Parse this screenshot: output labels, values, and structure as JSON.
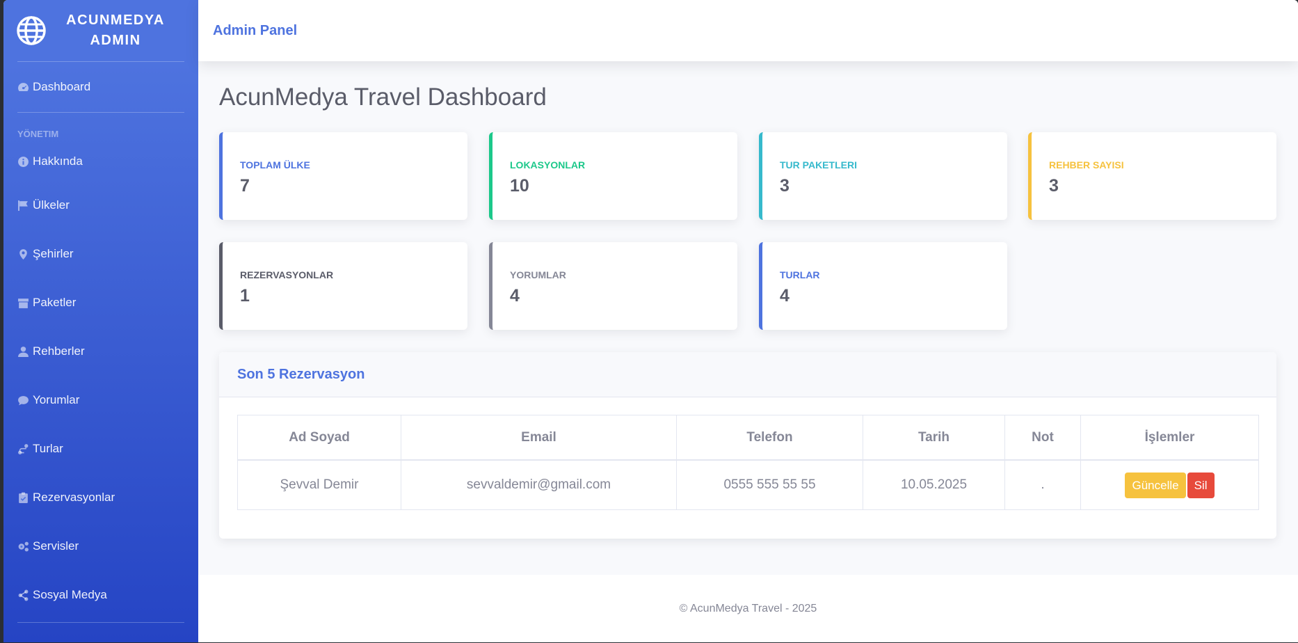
{
  "sidebar": {
    "brand": "ACUNMEDYA ADMIN",
    "dashboard": "Dashboard",
    "heading": "YÖNETIM",
    "items": [
      {
        "label": "Hakkında",
        "icon": "info-icon"
      },
      {
        "label": "Ülkeler",
        "icon": "flag-icon"
      },
      {
        "label": "Şehirler",
        "icon": "map-marker-icon"
      },
      {
        "label": "Paketler",
        "icon": "box-icon"
      },
      {
        "label": "Rehberler",
        "icon": "user-tie-icon"
      },
      {
        "label": "Yorumlar",
        "icon": "comment-icon"
      },
      {
        "label": "Turlar",
        "icon": "route-icon"
      },
      {
        "label": "Rezervasyonlar",
        "icon": "clipboard-check-icon"
      },
      {
        "label": "Servisler",
        "icon": "cogs-icon"
      },
      {
        "label": "Sosyal Medya",
        "icon": "share-icon"
      }
    ]
  },
  "topbar": {
    "title": "Admin Panel"
  },
  "page": {
    "title": "AcunMedya Travel Dashboard"
  },
  "cards": [
    {
      "label": "TOPLAM ÜLKE",
      "value": "7",
      "color": "#4e73df"
    },
    {
      "label": "LOKASYONLAR",
      "value": "10",
      "color": "#1cc88a"
    },
    {
      "label": "TUR PAKETLERI",
      "value": "3",
      "color": "#36b9cc"
    },
    {
      "label": "REHBER SAYISI",
      "value": "3",
      "color": "#f6c23e"
    },
    {
      "label": "REZERVASYONLAR",
      "value": "1",
      "color": "#5a5c69"
    },
    {
      "label": "YORUMLAR",
      "value": "4",
      "color": "#858796"
    },
    {
      "label": "TURLAR",
      "value": "4",
      "color": "#4e73df"
    }
  ],
  "reservations": {
    "title": "Son 5 Rezervasyon",
    "columns": [
      "Ad Soyad",
      "Email",
      "Telefon",
      "Tarih",
      "Not",
      "İşlemler"
    ],
    "rows": [
      {
        "name": "Şevval Demir",
        "email": "sevvaldemir@gmail.com",
        "phone": "0555 555 55 55",
        "date": "10.05.2025",
        "note": ".",
        "update_label": "Güncelle",
        "delete_label": "Sil"
      }
    ]
  },
  "footer": {
    "text": "© AcunMedya Travel - 2025"
  }
}
